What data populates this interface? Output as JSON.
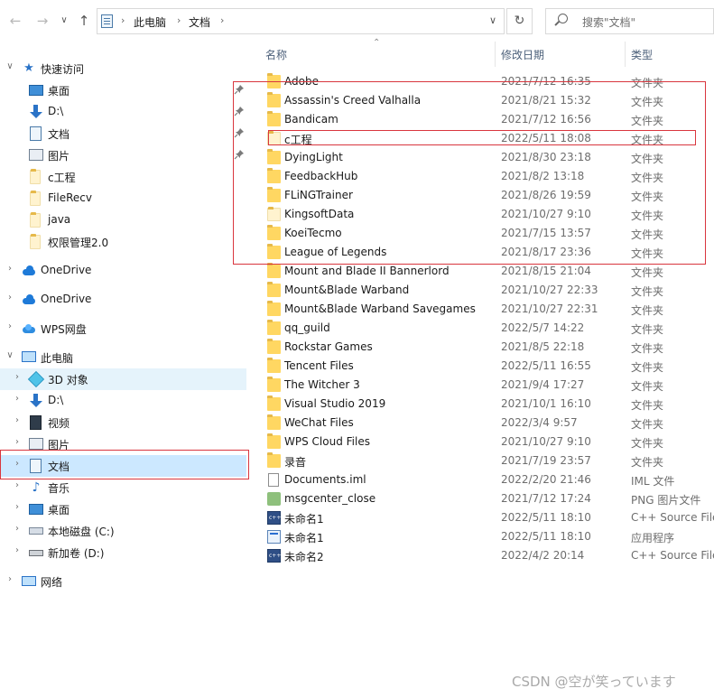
{
  "toolbar": {
    "back": "←",
    "forward": "→",
    "recent": "∨",
    "up": "↑",
    "breadcrumb": [
      "此电脑",
      "文档"
    ],
    "search_placeholder": "搜索\"文档\"",
    "refresh": "↻"
  },
  "columns": {
    "name": "名称",
    "date": "修改日期",
    "type": "类型"
  },
  "nav": {
    "quick_access": "快速访问",
    "quick_items": [
      {
        "label": "桌面",
        "icon": "desktop-icon"
      },
      {
        "label": "D:\\",
        "icon": "download-icon"
      },
      {
        "label": "文档",
        "icon": "document-icon"
      },
      {
        "label": "图片",
        "icon": "picture-icon"
      },
      {
        "label": "c工程",
        "icon": "folder-icon"
      },
      {
        "label": "FileRecv",
        "icon": "folder-icon"
      },
      {
        "label": "java",
        "icon": "folder-icon"
      },
      {
        "label": "权限管理2.0",
        "icon": "folder-icon"
      }
    ],
    "onedrive1": "OneDrive",
    "onedrive2": "OneDrive",
    "wps": "WPS网盘",
    "this_pc": "此电脑",
    "pc_items": [
      {
        "label": "3D 对象",
        "icon": "3d-objects-icon"
      },
      {
        "label": "D:\\",
        "icon": "download-icon"
      },
      {
        "label": "视频",
        "icon": "video-icon"
      },
      {
        "label": "图片",
        "icon": "picture-icon"
      },
      {
        "label": "文档",
        "icon": "document-icon"
      },
      {
        "label": "音乐",
        "icon": "music-icon"
      },
      {
        "label": "桌面",
        "icon": "desktop-icon"
      },
      {
        "label": "本地磁盘 (C:)",
        "icon": "drive-icon"
      },
      {
        "label": "新加卷 (D:)",
        "icon": "drive-icon"
      }
    ],
    "network": "网络"
  },
  "files": [
    {
      "name": "Adobe",
      "date": "2021/7/12 16:35",
      "type": "文件夹",
      "icon": "folder"
    },
    {
      "name": "Assassin's Creed Valhalla",
      "date": "2021/8/21 15:32",
      "type": "文件夹",
      "icon": "folder"
    },
    {
      "name": "Bandicam",
      "date": "2021/7/12 16:56",
      "type": "文件夹",
      "icon": "folder"
    },
    {
      "name": "c工程",
      "date": "2022/5/11 18:08",
      "type": "文件夹",
      "icon": "folder"
    },
    {
      "name": "DyingLight",
      "date": "2021/8/30 23:18",
      "type": "文件夹",
      "icon": "folder"
    },
    {
      "name": "FeedbackHub",
      "date": "2021/8/2 13:18",
      "type": "文件夹",
      "icon": "folder"
    },
    {
      "name": "FLiNGTrainer",
      "date": "2021/8/26 19:59",
      "type": "文件夹",
      "icon": "folder"
    },
    {
      "name": "KingsoftData",
      "date": "2021/10/27 9:10",
      "type": "文件夹",
      "icon": "folder-light"
    },
    {
      "name": "KoeiTecmo",
      "date": "2021/7/15 13:57",
      "type": "文件夹",
      "icon": "folder"
    },
    {
      "name": "League of Legends",
      "date": "2021/8/17 23:36",
      "type": "文件夹",
      "icon": "folder"
    },
    {
      "name": "Mount and Blade II Bannerlord",
      "date": "2021/8/15 21:04",
      "type": "文件夹",
      "icon": "folder"
    },
    {
      "name": "Mount&Blade Warband",
      "date": "2021/10/27 22:33",
      "type": "文件夹",
      "icon": "folder"
    },
    {
      "name": "Mount&Blade Warband Savegames",
      "date": "2021/10/27 22:31",
      "type": "文件夹",
      "icon": "folder"
    },
    {
      "name": "qq_guild",
      "date": "2022/5/7 14:22",
      "type": "文件夹",
      "icon": "folder"
    },
    {
      "name": "Rockstar Games",
      "date": "2021/8/5 22:18",
      "type": "文件夹",
      "icon": "folder"
    },
    {
      "name": "Tencent Files",
      "date": "2022/5/11 16:55",
      "type": "文件夹",
      "icon": "folder"
    },
    {
      "name": "The Witcher 3",
      "date": "2021/9/4 17:27",
      "type": "文件夹",
      "icon": "folder"
    },
    {
      "name": "Visual Studio 2019",
      "date": "2021/10/1 16:10",
      "type": "文件夹",
      "icon": "folder"
    },
    {
      "name": "WeChat Files",
      "date": "2022/3/4 9:57",
      "type": "文件夹",
      "icon": "folder"
    },
    {
      "name": "WPS Cloud Files",
      "date": "2021/10/27 9:10",
      "type": "文件夹",
      "icon": "folder"
    },
    {
      "name": "录音",
      "date": "2021/7/19 23:57",
      "type": "文件夹",
      "icon": "folder"
    },
    {
      "name": "Documents.iml",
      "date": "2022/2/20 21:46",
      "type": "IML 文件",
      "icon": "file"
    },
    {
      "name": "msgcenter_close",
      "date": "2021/7/12 17:24",
      "type": "PNG 图片文件",
      "icon": "png"
    },
    {
      "name": "未命名1",
      "date": "2022/5/11 18:10",
      "type": "C++ Source File",
      "icon": "cpp"
    },
    {
      "name": "未命名1",
      "date": "2022/5/11 18:10",
      "type": "应用程序",
      "icon": "exe"
    },
    {
      "name": "未命名2",
      "date": "2022/4/2 20:14",
      "type": "C++ Source File",
      "icon": "cpp"
    }
  ],
  "watermark": "CSDN @空が笑っています"
}
